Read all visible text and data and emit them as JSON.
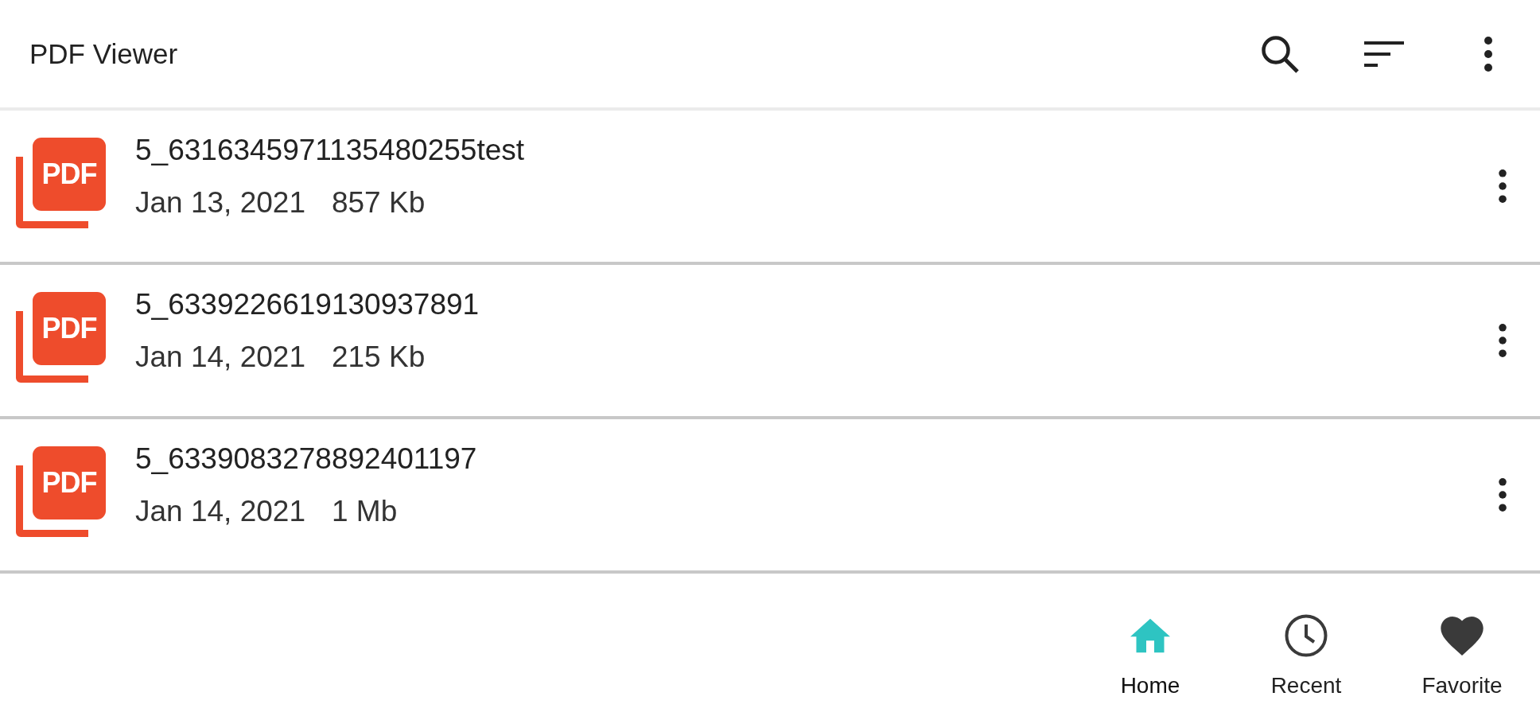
{
  "app_bar": {
    "title": "PDF Viewer"
  },
  "files": [
    {
      "icon_label": "PDF",
      "name": "5_6316345971135480255test",
      "date": "Jan 13, 2021",
      "size": "857 Kb"
    },
    {
      "icon_label": "PDF",
      "name": "5_6339226619130937891",
      "date": "Jan 14, 2021",
      "size": "215 Kb"
    },
    {
      "icon_label": "PDF",
      "name": "5_6339083278892401197",
      "date": "Jan 14, 2021",
      "size": "1 Mb"
    }
  ],
  "bottom_nav": [
    {
      "kind": "home",
      "label": "Home",
      "selected": true
    },
    {
      "kind": "recent",
      "label": "Recent",
      "selected": false
    },
    {
      "kind": "favorite",
      "label": "Favorite",
      "selected": false
    }
  ]
}
